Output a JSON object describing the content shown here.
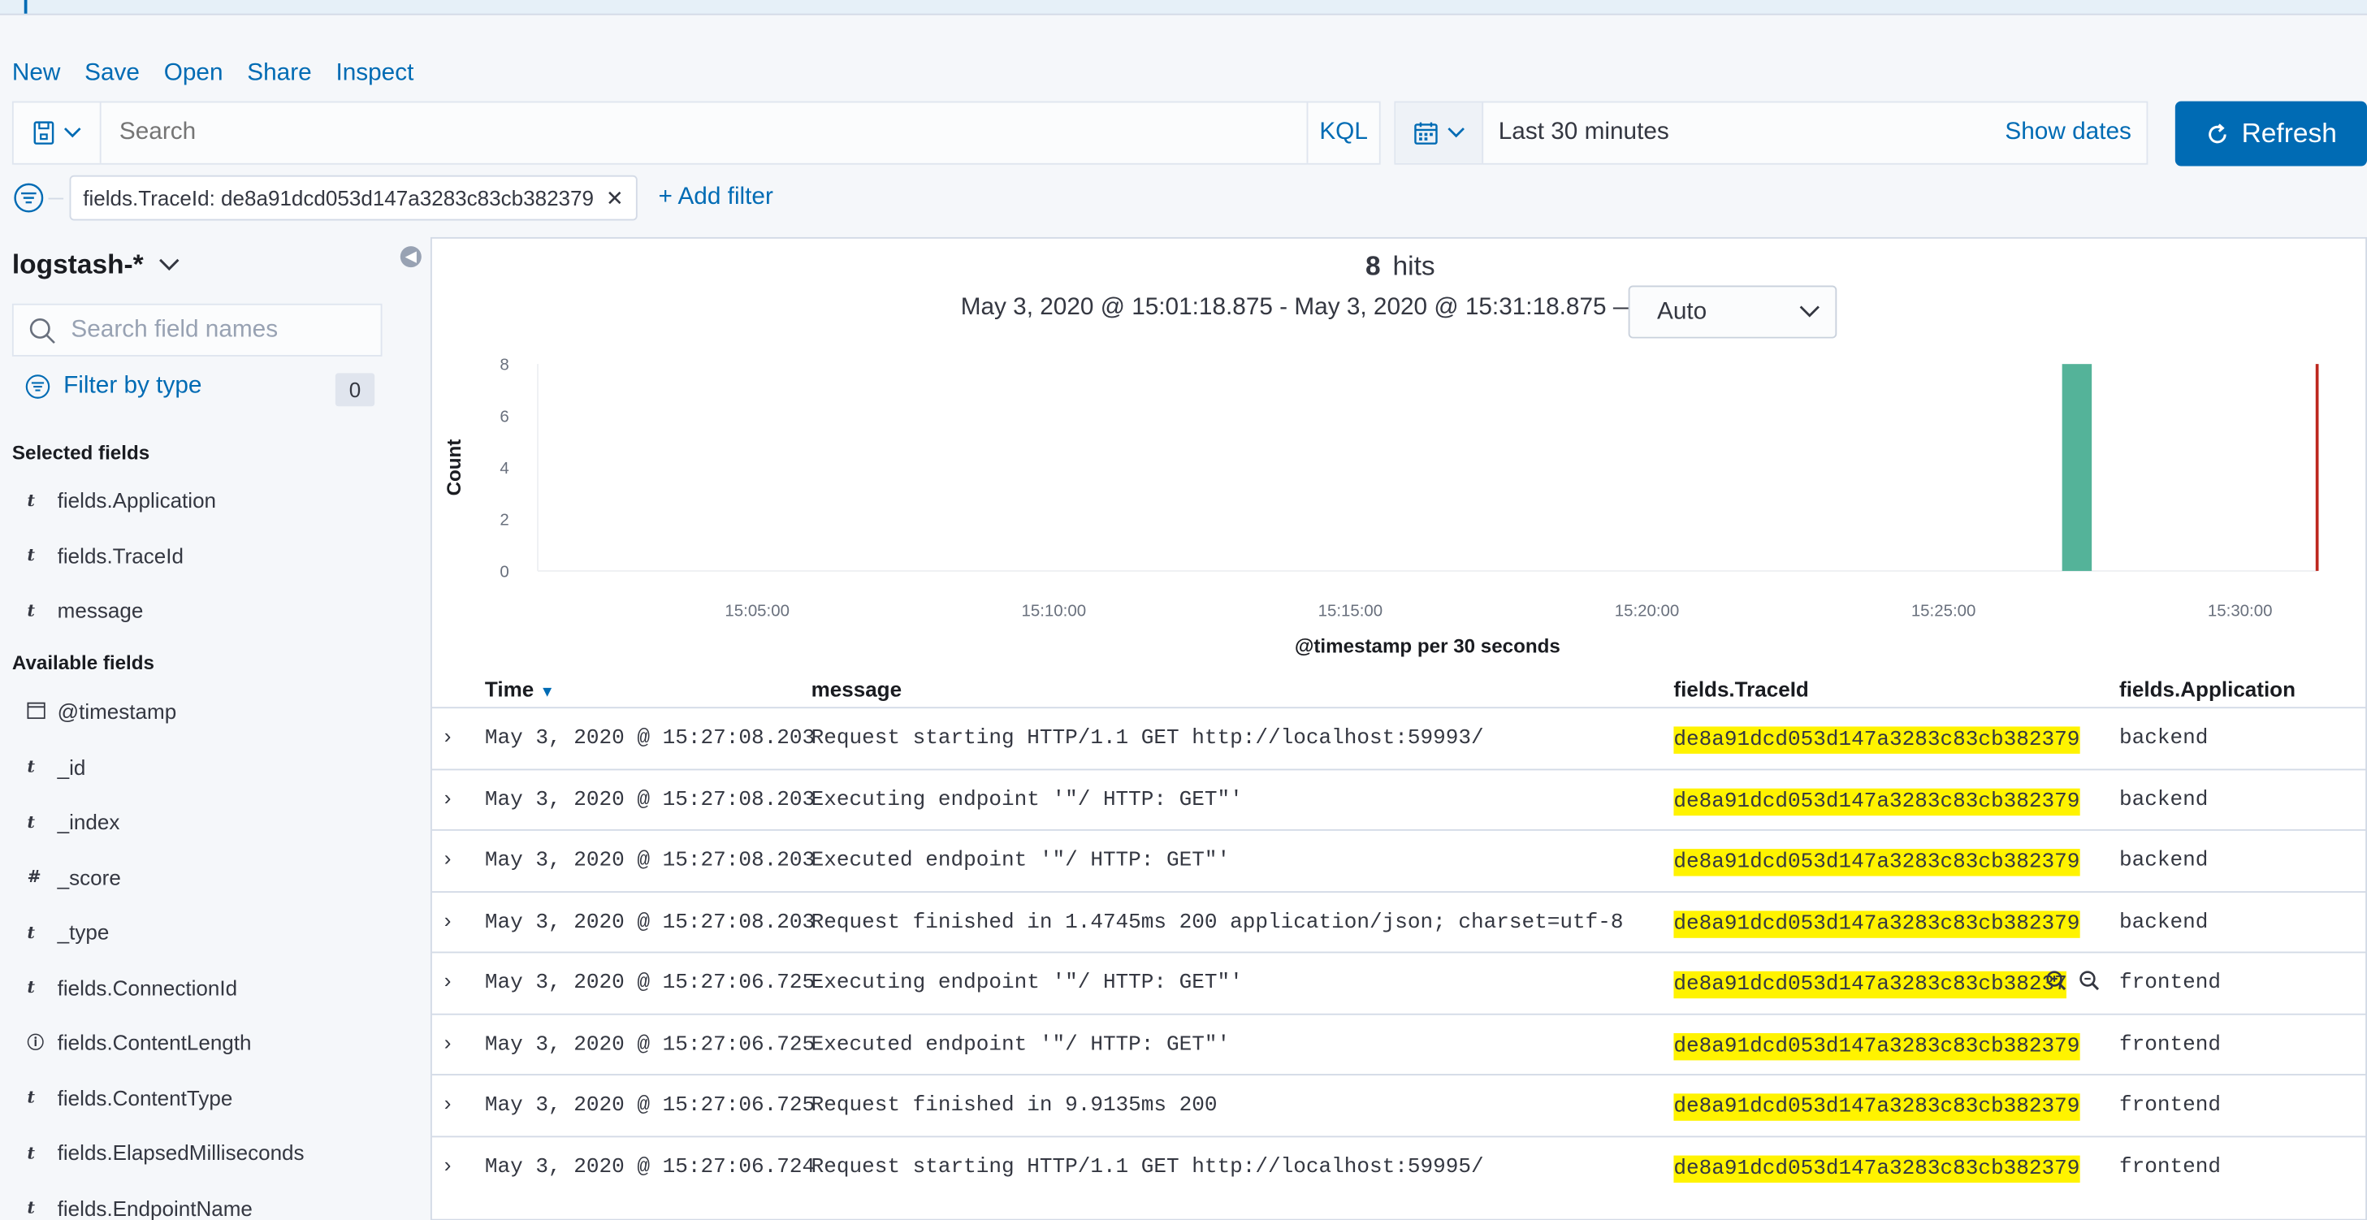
{
  "menu": [
    "New",
    "Save",
    "Open",
    "Share",
    "Inspect"
  ],
  "query": {
    "placeholder": "Search",
    "language": "KQL"
  },
  "time": {
    "range": "Last 30 minutes",
    "show_dates": "Show dates",
    "refresh": "Refresh"
  },
  "filter": {
    "pill": "fields.TraceId: de8a91dcd053d147a3283c83cb382379",
    "add": "+ Add filter"
  },
  "sidebar": {
    "index_pattern": "logstash-*",
    "search_placeholder": "Search field names",
    "filter_by_type": "Filter by type",
    "filter_count": "0",
    "selected_header": "Selected fields",
    "selected": [
      {
        "type": "t",
        "name": "fields.Application"
      },
      {
        "type": "t",
        "name": "fields.TraceId"
      },
      {
        "type": "t",
        "name": "message"
      }
    ],
    "available_header": "Available fields",
    "available": [
      {
        "type": "cal",
        "name": "@timestamp"
      },
      {
        "type": "t",
        "name": "_id"
      },
      {
        "type": "t",
        "name": "_index"
      },
      {
        "type": "#",
        "name": "_score"
      },
      {
        "type": "t",
        "name": "_type"
      },
      {
        "type": "t",
        "name": "fields.ConnectionId"
      },
      {
        "type": "?",
        "name": "fields.ContentLength"
      },
      {
        "type": "t",
        "name": "fields.ContentType"
      },
      {
        "type": "t",
        "name": "fields.ElapsedMilliseconds"
      },
      {
        "type": "t",
        "name": "fields.EndpointName"
      }
    ]
  },
  "results": {
    "hits": "8",
    "hits_label": "hits",
    "range": "May 3, 2020 @ 15:01:18.875 - May 3, 2020 @ 15:31:18.875 —",
    "interval": "Auto"
  },
  "chart_data": {
    "type": "bar",
    "ylabel": "Count",
    "xlabel": "@timestamp per 30 seconds",
    "y_ticks": [
      "0",
      "2",
      "4",
      "6",
      "8"
    ],
    "x_ticks": [
      "15:05:00",
      "15:10:00",
      "15:15:00",
      "15:20:00",
      "15:25:00",
      "15:30:00"
    ],
    "ylim": [
      0,
      8
    ],
    "bars": [
      {
        "x": "15:27:00",
        "value": 8
      }
    ],
    "now_marker": "15:31:18",
    "colors": {
      "bar": "#54b399",
      "marker": "#bd271e"
    }
  },
  "table": {
    "columns": [
      "Time",
      "message",
      "fields.TraceId",
      "fields.Application"
    ],
    "rows": [
      {
        "time": "May 3, 2020 @ 15:27:08.203",
        "message": "Request starting HTTP/1.1 GET http://localhost:59993/",
        "trace": "de8a91dcd053d147a3283c83cb382379",
        "app": "backend"
      },
      {
        "time": "May 3, 2020 @ 15:27:08.203",
        "message": "Executing endpoint '\"/ HTTP: GET\"'",
        "trace": "de8a91dcd053d147a3283c83cb382379",
        "app": "backend"
      },
      {
        "time": "May 3, 2020 @ 15:27:08.203",
        "message": "Executed endpoint '\"/ HTTP: GET\"'",
        "trace": "de8a91dcd053d147a3283c83cb382379",
        "app": "backend"
      },
      {
        "time": "May 3, 2020 @ 15:27:08.203",
        "message": "Request finished in 1.4745ms 200 application/json; charset=utf-8",
        "trace": "de8a91dcd053d147a3283c83cb382379",
        "app": "backend"
      },
      {
        "time": "May 3, 2020 @ 15:27:06.725",
        "message": "Executing endpoint '\"/ HTTP: GET\"'",
        "trace": "de8a91dcd053d147a3283c83cb38237",
        "app": "frontend"
      },
      {
        "time": "May 3, 2020 @ 15:27:06.725",
        "message": "Executed endpoint '\"/ HTTP: GET\"'",
        "trace": "de8a91dcd053d147a3283c83cb382379",
        "app": "frontend"
      },
      {
        "time": "May 3, 2020 @ 15:27:06.725",
        "message": "Request finished in 9.9135ms 200",
        "trace": "de8a91dcd053d147a3283c83cb382379",
        "app": "frontend"
      },
      {
        "time": "May 3, 2020 @ 15:27:06.724",
        "message": "Request starting HTTP/1.1 GET http://localhost:59995/",
        "trace": "de8a91dcd053d147a3283c83cb382379",
        "app": "frontend"
      }
    ]
  }
}
